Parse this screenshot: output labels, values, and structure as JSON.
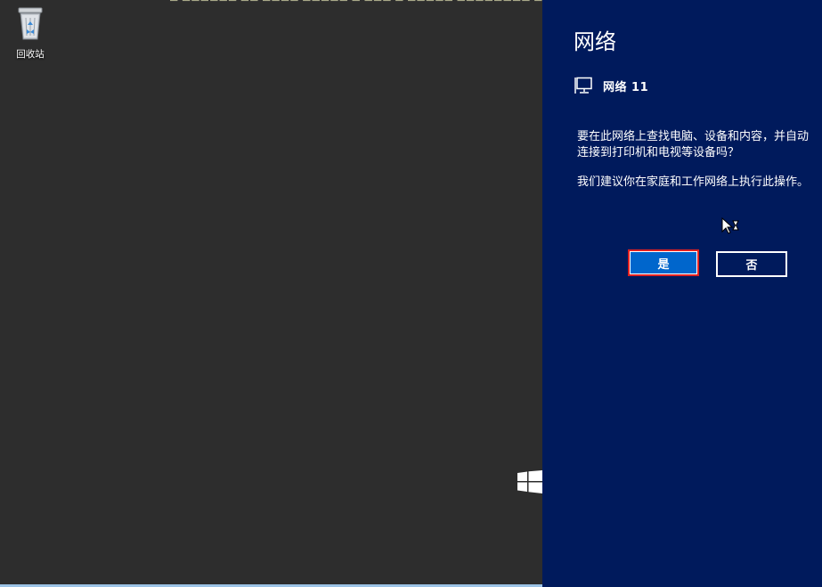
{
  "desktop": {
    "recycle_bin": {
      "label": "回收站",
      "icon": "recycle-bin-icon"
    },
    "windows_logo_icon": "windows-logo-icon"
  },
  "network_panel": {
    "title": "网络",
    "network_icon": "network-monitor-icon",
    "network_name": "网络 11",
    "message_line1": "要在此网络上查找电脑、设备和内容，并自动连接到打印机和电视等设备吗？",
    "message_line2": "我们建议你在家庭和工作网络上执行此操作。",
    "yes_label": "是",
    "no_label": "否"
  },
  "colors": {
    "panel_bg": "#001a5c",
    "desktop_bg": "#2d2d2d",
    "yes_button": "#0066cc",
    "highlight_border": "#e02020"
  }
}
